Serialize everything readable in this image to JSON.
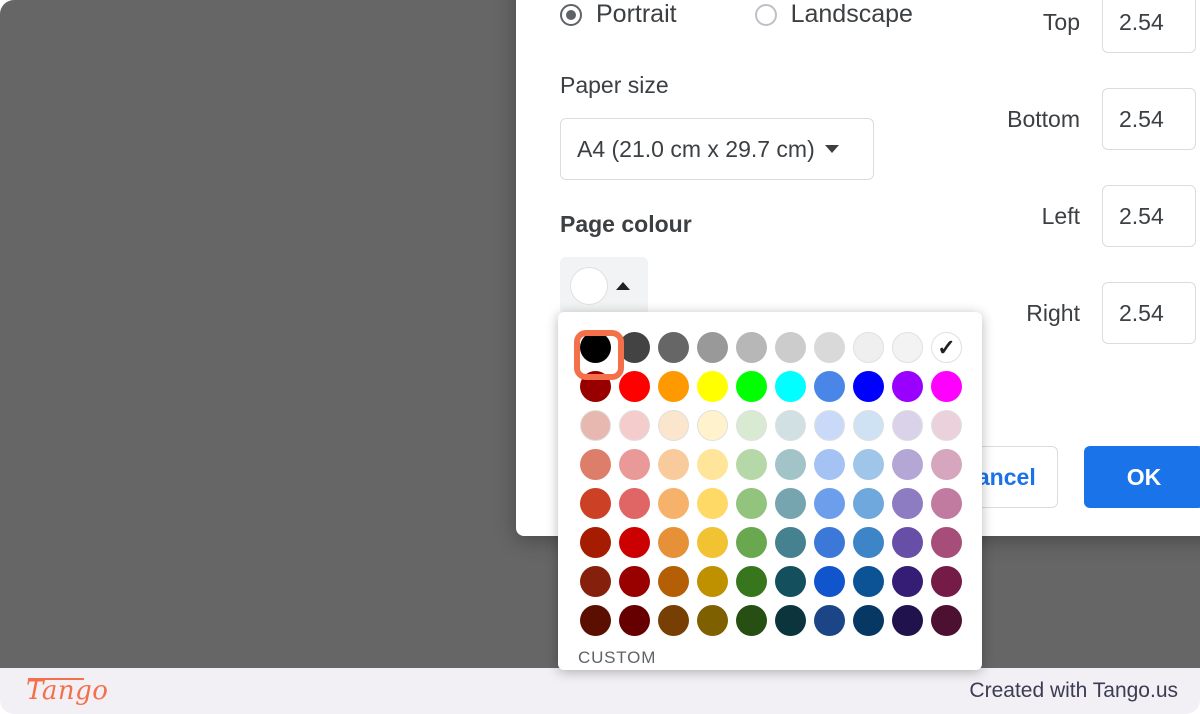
{
  "app": {
    "backdrop_color": "#666666",
    "accent_color": "#1a73e8",
    "highlight_color": "#f4704a"
  },
  "dialog": {
    "orientation": {
      "options": [
        {
          "label": "Portrait",
          "checked": true
        },
        {
          "label": "Landscape",
          "checked": false
        }
      ]
    },
    "paper_size": {
      "label": "Paper size",
      "value": "A4 (21.0 cm x 29.7 cm)",
      "caret_icon": "chevron-down-icon"
    },
    "page_colour": {
      "label": "Page colour",
      "selected_swatch": "#ffffff",
      "caret_icon": "chevron-up-icon"
    },
    "margins": {
      "rows": [
        {
          "name": "Top",
          "value": "2.54"
        },
        {
          "name": "Bottom",
          "value": "2.54"
        },
        {
          "name": "Left",
          "value": "2.54"
        },
        {
          "name": "Right",
          "value": "2.54"
        }
      ]
    },
    "actions": {
      "cancel_label": "Cancel",
      "ok_label": "OK"
    }
  },
  "palette": {
    "custom_label": "CUSTOM",
    "checked_color": "#ffffff",
    "highlighted_color": "#000000",
    "check_icon": "check-icon",
    "rows": [
      [
        "#000000",
        "#434343",
        "#666666",
        "#999999",
        "#b7b7b7",
        "#cccccc",
        "#d9d9d9",
        "#efefef",
        "#f3f3f3",
        "#ffffff"
      ],
      [
        "#980000",
        "#ff0000",
        "#ff9900",
        "#ffff00",
        "#00ff00",
        "#00ffff",
        "#4a86e8",
        "#0000ff",
        "#9900ff",
        "#ff00ff"
      ],
      [
        "#e6b8af",
        "#f4cccc",
        "#fce5cd",
        "#fff2cc",
        "#d9ead3",
        "#d0e0e3",
        "#c9daf8",
        "#cfe2f3",
        "#d9d2e9",
        "#ead1dc"
      ],
      [
        "#dd7e6b",
        "#ea9999",
        "#f9cb9c",
        "#ffe599",
        "#b6d7a8",
        "#a2c4c9",
        "#a4c2f4",
        "#9fc5e8",
        "#b4a7d6",
        "#d5a6bd"
      ],
      [
        "#cc4125",
        "#e06666",
        "#f6b26b",
        "#ffd966",
        "#93c47d",
        "#76a5af",
        "#6d9eeb",
        "#6fa8dc",
        "#8e7cc3",
        "#c27ba0"
      ],
      [
        "#a61c00",
        "#cc0000",
        "#e69138",
        "#f1c232",
        "#6aa84f",
        "#45818e",
        "#3c78d8",
        "#3d85c6",
        "#674ea7",
        "#a64d79"
      ],
      [
        "#85200c",
        "#990000",
        "#b45f06",
        "#bf9000",
        "#38761d",
        "#134f5c",
        "#1155cc",
        "#0b5394",
        "#351c75",
        "#741b47"
      ],
      [
        "#5b0f00",
        "#660000",
        "#783f04",
        "#7f6000",
        "#274e13",
        "#0c343d",
        "#1c4587",
        "#073763",
        "#20124d",
        "#4c1130"
      ]
    ]
  },
  "footer": {
    "logo_text": "Tango",
    "note": "Created with Tango.us"
  }
}
